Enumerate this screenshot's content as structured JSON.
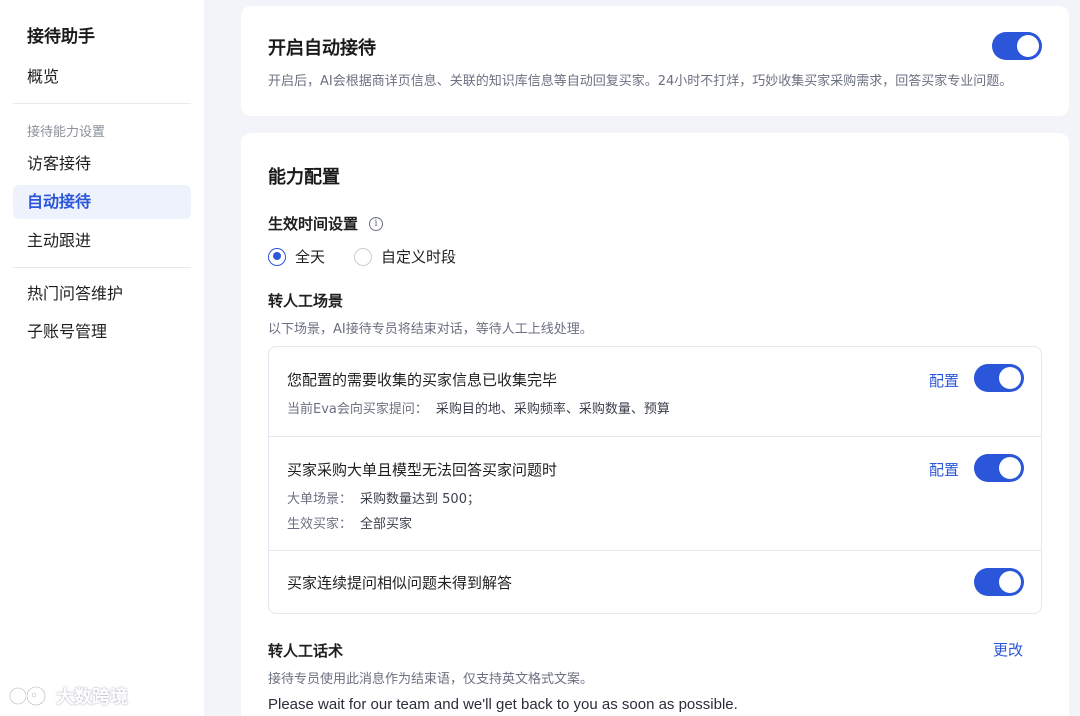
{
  "sidebar": {
    "title": "接待助手",
    "overview": "概览",
    "group_label": "接待能力设置",
    "items": [
      {
        "label": "访客接待"
      },
      {
        "label": "自动接待"
      },
      {
        "label": "主动跟进"
      }
    ],
    "faq": "热门问答维护",
    "subaccount": "子账号管理"
  },
  "auto_reception": {
    "title": "开启自动接待",
    "description": "开启后，AI会根据商详页信息、关联的知识库信息等自动回复买家。24小时不打烊，巧妙收集买家采购需求，回答买家专业问题。",
    "enabled": true
  },
  "capability": {
    "title": "能力配置",
    "effective_time": {
      "label": "生效时间设置",
      "info_icon": "info-icon",
      "options": [
        "全天",
        "自定义时段"
      ],
      "selected": "全天"
    },
    "handoff": {
      "title": "转人工场景",
      "description": "以下场景，AI接待专员将结束对话，等待人工上线处理。",
      "scenarios": [
        {
          "title": "您配置的需要收集的买家信息已收集完毕",
          "sub": [
            {
              "label": "当前Eva会向买家提问：",
              "value": "采购目的地、采购频率、采购数量、预算"
            }
          ],
          "config_label": "配置",
          "enabled": true
        },
        {
          "title": "买家采购大单且模型无法回答买家问题时",
          "sub": [
            {
              "label": "大单场景：",
              "value": "采购数量达到 500；"
            },
            {
              "label": "生效买家：",
              "value": "全部买家"
            }
          ],
          "config_label": "配置",
          "enabled": true
        },
        {
          "title": "买家连续提问相似问题未得到解答",
          "enabled": true
        }
      ]
    },
    "script": {
      "title": "转人工话术",
      "edit_label": "更改",
      "description": "接待专员使用此消息作为结束语，仅支持英文格式文案。",
      "message": "Please wait for our team and we'll get back to you as soon as possible."
    }
  },
  "watermark": {
    "text": "大数跨境"
  },
  "colors": {
    "accent": "#2b56d9",
    "background": "#f2f4fa",
    "active_bg": "#eef2fd"
  }
}
